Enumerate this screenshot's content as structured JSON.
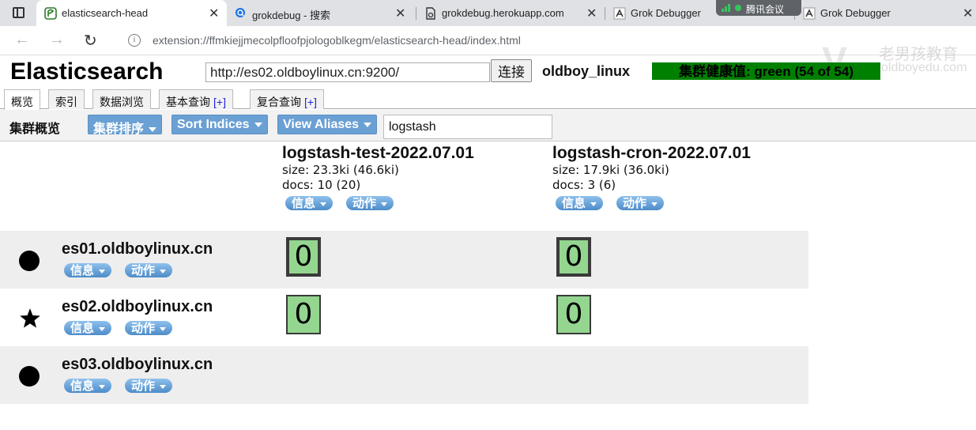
{
  "browser": {
    "tabs": [
      {
        "title": "elasticsearch-head",
        "active": true
      },
      {
        "title": "grokdebug - 搜索",
        "active": false
      },
      {
        "title": "grokdebug.herokuapp.com",
        "active": false
      },
      {
        "title": "Grok Debugger",
        "active": false
      },
      {
        "title": "Grok Debugger",
        "active": false
      }
    ],
    "meeting_label": "腾讯会议",
    "address": "extension://ffmkiejjmecolpfloofpjologoblkegm/elasticsearch-head/index.html",
    "close_glyph": "✕",
    "back_glyph": "←",
    "forward_glyph": "→",
    "reload_glyph": "↻",
    "info_glyph": "i"
  },
  "watermark": {
    "line1": "老男孩教育",
    "line2": "oldboyedu.com",
    "mark": "V"
  },
  "header": {
    "title": "Elasticsearch",
    "url_value": "http://es02.oldboylinux.cn:9200/",
    "connect_label": "连接",
    "cluster_name": "oldboy_linux",
    "health": "集群健康值: green (54 of 54)"
  },
  "tabs": [
    {
      "label": "概览",
      "plus": ""
    },
    {
      "label": "索引",
      "plus": ""
    },
    {
      "label": "数据浏览",
      "plus": ""
    },
    {
      "label": "基本查询",
      "plus": "[+]"
    },
    {
      "label": "复合查询",
      "plus": "[+]"
    }
  ],
  "toolbar": {
    "title": "集群概览",
    "sort_cluster": "集群排序",
    "sort_indices": "Sort Indices",
    "view_aliases": "View Aliases",
    "filter_value": "logstash"
  },
  "indices": [
    {
      "name": "logstash-test-2022.07.01",
      "size": "size: 23.3ki (46.6ki)",
      "docs": "docs: 10 (20)",
      "info_label": "信息",
      "action_label": "动作"
    },
    {
      "name": "logstash-cron-2022.07.01",
      "size": "size: 17.9ki (36.0ki)",
      "docs": "docs: 3 (6)",
      "info_label": "信息",
      "action_label": "动作"
    }
  ],
  "nodes": [
    {
      "name": "es01.oldboylinux.cn",
      "icon": "circle",
      "info_label": "信息",
      "action_label": "动作",
      "shards": [
        "0",
        "0"
      ],
      "primary": [
        true,
        true
      ]
    },
    {
      "name": "es02.oldboylinux.cn",
      "icon": "star",
      "info_label": "信息",
      "action_label": "动作",
      "shards": [
        "0",
        "0"
      ],
      "primary": [
        false,
        false
      ]
    },
    {
      "name": "es03.oldboylinux.cn",
      "icon": "circle",
      "info_label": "信息",
      "action_label": "动作",
      "shards": [],
      "primary": []
    }
  ],
  "colors": {
    "health_green": "#008000",
    "shard_green": "#94d690",
    "button_blue": "#6aa0d3",
    "row_grey": "#eeeeee"
  }
}
